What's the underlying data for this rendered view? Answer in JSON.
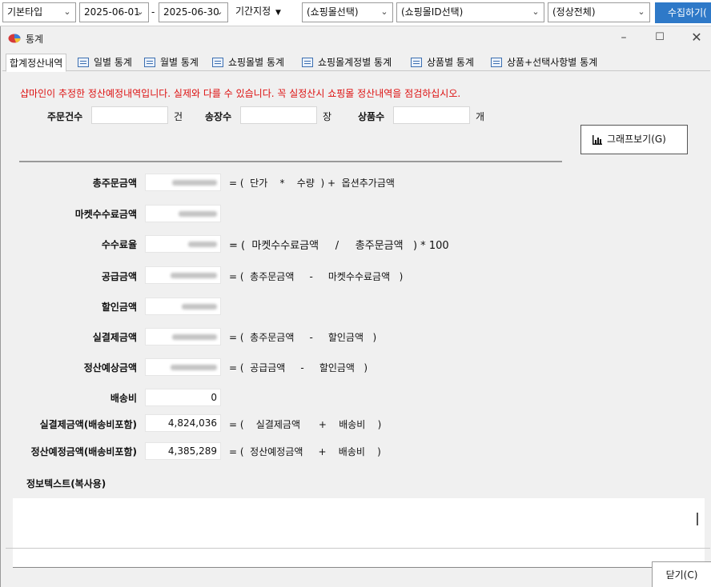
{
  "toolbar": {
    "type_select": "기본타입",
    "date_from": "2025-06-01",
    "date_sep": "-",
    "date_to": "2025-06-30",
    "period_btn": "기간지정",
    "mall_select": "(쇼핑몰선택)",
    "mall_id_select": "(쇼핑몰ID선택)",
    "status_select": "(정상전체)",
    "collect_btn": "수집하기("
  },
  "window": {
    "title": "통계",
    "tabs": [
      {
        "label": "합계정산내역",
        "active": true
      },
      {
        "label": "일별 통계"
      },
      {
        "label": "월별 통계"
      },
      {
        "label": "쇼핑몰별 통계"
      },
      {
        "label": "쇼핑몰계정별 통계"
      },
      {
        "label": "상품별 통계"
      },
      {
        "label": "상품+선택사항별 통계"
      }
    ]
  },
  "summary": {
    "notice": "샵마인이 추정한 정산예정내역입니다. 실제와 다를 수 있습니다. 꼭 실정산시 쇼핑몰 정산내역을 점검하십시오.",
    "order_count_label": "주문건수",
    "order_count_value": "",
    "order_count_unit": "건",
    "invoice_label": "송장수",
    "invoice_value": "",
    "invoice_unit": "장",
    "product_label": "상품수",
    "product_value": "",
    "product_unit": "개",
    "graph_btn": "그래프보기(G)"
  },
  "rows": [
    {
      "label": "총주문금액",
      "value": "",
      "formula": "= (  단가    *    수량  ) +  옵션추가금액"
    },
    {
      "label": "마켓수수료금액",
      "value": "",
      "formula": ""
    },
    {
      "label": "수수료율",
      "value": "",
      "formula": "= (  마켓수수료금액     /     총주문금액   ) * 100"
    },
    {
      "label": "공급금액",
      "value": "",
      "formula": "= (  총주문금액     -     마켓수수료금액   )"
    },
    {
      "label": "할인금액",
      "value": "",
      "formula": ""
    },
    {
      "label": "실결제금액",
      "value": "",
      "formula": "= (  총주문금액     -     할인금액   )"
    },
    {
      "label": "정산예상금액",
      "value": "",
      "formula": "= (  공급금액     -     할인금액   )"
    },
    {
      "label": "배송비",
      "value": "0",
      "formula": ""
    },
    {
      "label": "실결제금액(배송비포함)",
      "value": "4,824,036",
      "formula": "= (    실결제금액      +    배송비    )"
    },
    {
      "label": "정산예정금액(배송비포함)",
      "value": "4,385,289",
      "formula": "= (  정산예정금액     +    배송비    )"
    }
  ],
  "info": {
    "title": "정보텍스트(복사용)"
  },
  "footer": {
    "close_btn": "닫기(C)"
  }
}
